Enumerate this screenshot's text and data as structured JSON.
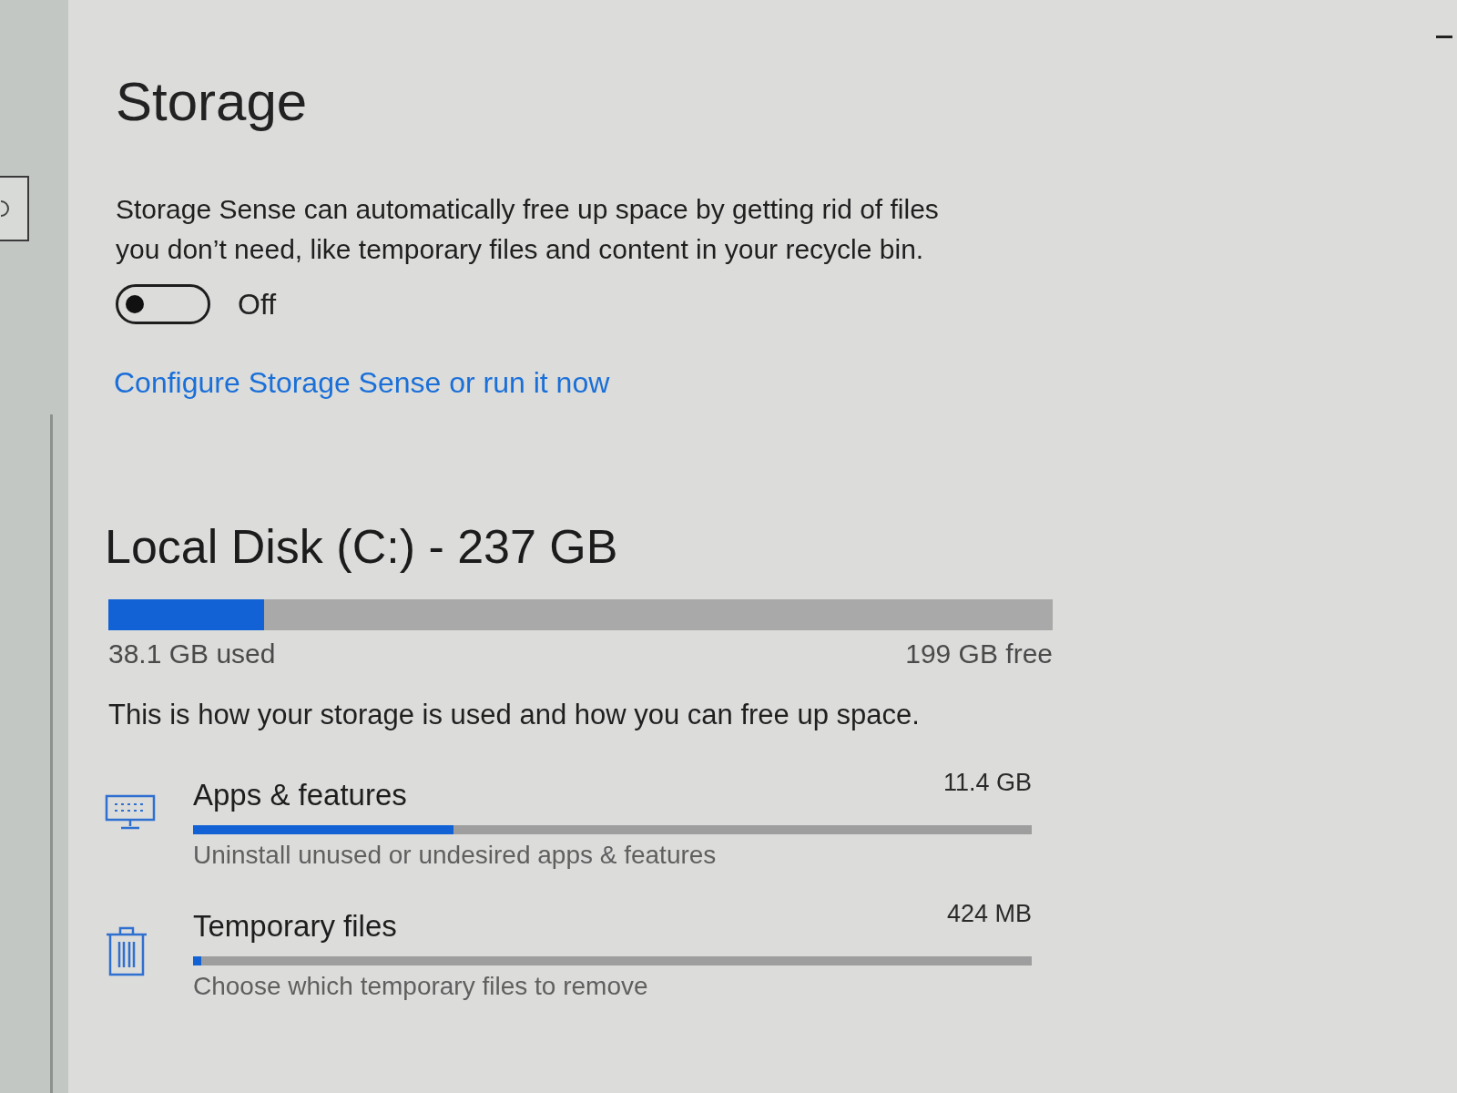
{
  "page": {
    "title": "Storage"
  },
  "storage_sense": {
    "description": "Storage Sense can automatically free up space by getting rid of files you don’t need, like temporary files and content in your recycle bin.",
    "toggle": {
      "on": false,
      "label": "Off"
    },
    "link": "Configure Storage Sense or run it now"
  },
  "disk": {
    "title": "Local Disk (C:) - 237 GB",
    "level": 0.165,
    "used": "38.1 GB used",
    "free": "199 GB free"
  },
  "intro": "This is how your storage is used and how you can free up space.",
  "categories": [
    {
      "kind": "apps",
      "name": "Apps & features",
      "size": "11.4 GB",
      "level": 0.31,
      "description": "Uninstall unused or undesired apps & features"
    },
    {
      "kind": "temp",
      "name": "Temporary files",
      "size": "424 MB",
      "level": 0.01,
      "description": "Choose which temporary files to remove"
    }
  ]
}
